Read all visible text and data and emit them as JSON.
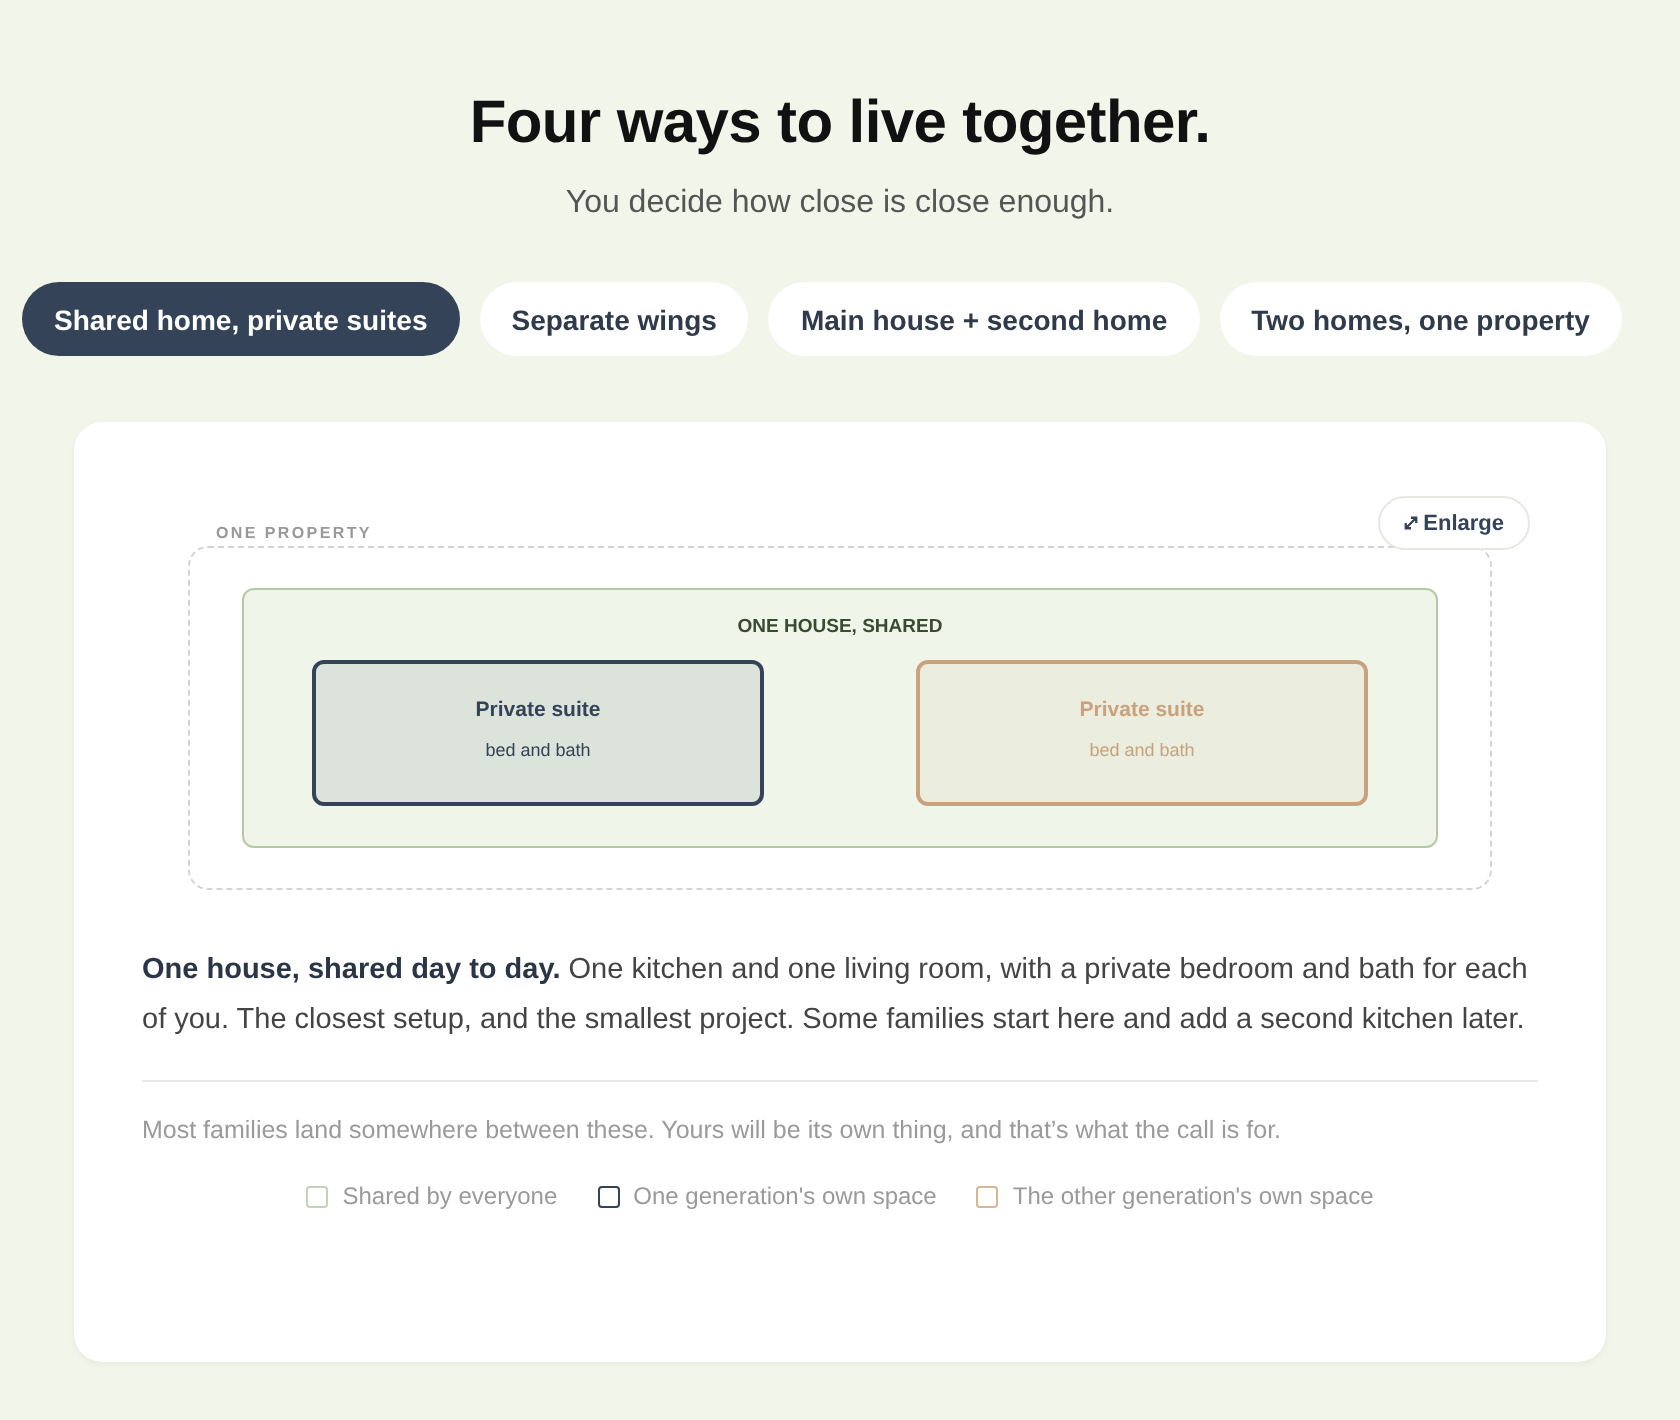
{
  "header": {
    "title": "Four ways to live together.",
    "subtitle": "You decide how close is close enough."
  },
  "tabs": [
    {
      "label": "Shared home, private suites",
      "selected": true
    },
    {
      "label": "Separate wings",
      "selected": false
    },
    {
      "label": "Main house + second home",
      "selected": false
    },
    {
      "label": "Two homes, one property",
      "selected": false
    }
  ],
  "diagram": {
    "property_label": "ONE PROPERTY",
    "enlarge_button": "Enlarge",
    "house_label": "ONE HOUSE, SHARED",
    "suites": [
      {
        "title": "Private suite",
        "detail": "bed and bath",
        "color": "#344358"
      },
      {
        "title": "Private suite",
        "detail": "bed and bath",
        "color": "#c9a27c"
      }
    ]
  },
  "description": "**One house, shared day to day.** One kitchen and one living room, with a private bedroom and bath for each of you. The closest setup, and the smallest project. Some families start here and add a second kitchen later.",
  "note": "Most families land somewhere between these. Yours will be its own thing, and that’s what the call is for.",
  "legend": [
    {
      "label": "Shared by everyone",
      "color": "#c4d3b3"
    },
    {
      "label": "One generation's own space",
      "color": "#344358"
    },
    {
      "label": "The other generation's own space",
      "color": "#d9b592"
    }
  ]
}
